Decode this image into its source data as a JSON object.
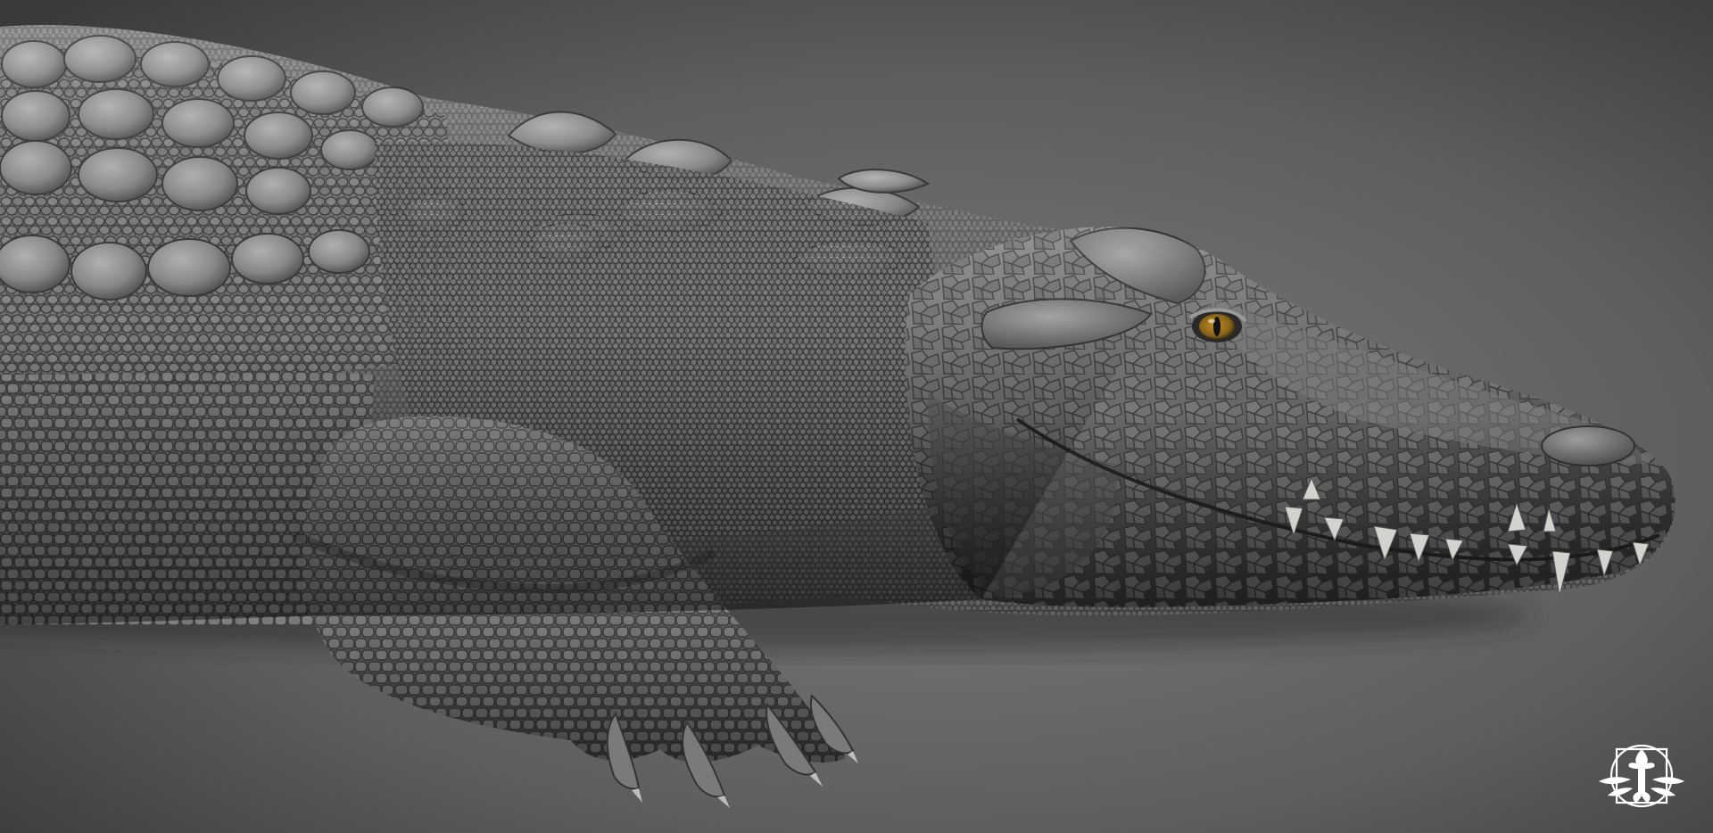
{
  "scene": {
    "subject": "crocodile-sculpt",
    "render_style": "grayscale clay sculpt",
    "colors": {
      "background_center": "#7c7c7c",
      "background_edge": "#3a3a3a",
      "skin_light": "#9a9a9a",
      "skin_mid": "#6e6e6e",
      "skin_dark": "#2e2e2e",
      "eye_iris": "#8a6418",
      "tooth": "#d2d2ce",
      "logo": "#ffffff"
    }
  },
  "logo": {
    "icon": "beetle-emblem-icon"
  }
}
